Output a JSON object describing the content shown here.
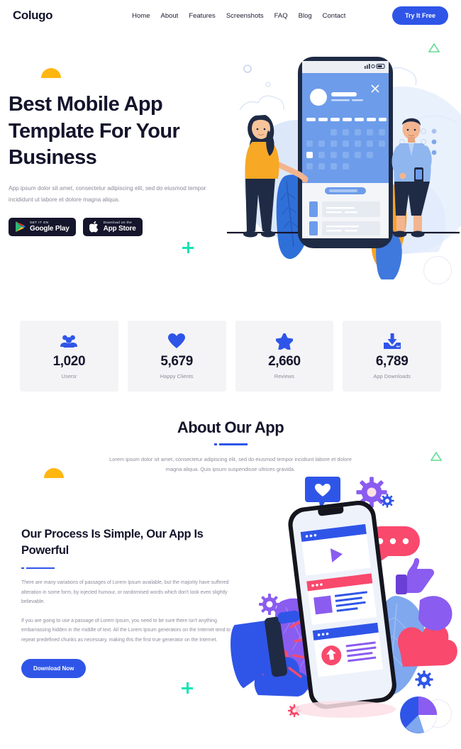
{
  "navbar": {
    "brand": "Colugo",
    "links": [
      {
        "label": "Home"
      },
      {
        "label": "About"
      },
      {
        "label": "Features"
      },
      {
        "label": "Screenshots"
      },
      {
        "label": "FAQ"
      },
      {
        "label": "Blog"
      },
      {
        "label": "Contact"
      }
    ],
    "cta": "Try It Free"
  },
  "hero": {
    "title": "Best Mobile App Template For Your Business",
    "subtitle": "App ipsum dolor sit amet, consectetur adipiscing elit, sed do eiusmod tempor incididunt ut labore et dolore magna aliqua.",
    "google_badge": {
      "top": "GET IT ON",
      "bottom": "Google Play"
    },
    "apple_badge": {
      "top": "Download on the",
      "bottom": "App Store"
    }
  },
  "stats": [
    {
      "icon": "users-icon",
      "value": "1,020",
      "label": "Usersr"
    },
    {
      "icon": "heart-icon",
      "value": "5,679",
      "label": "Happy Clients"
    },
    {
      "icon": "star-icon",
      "value": "2,660",
      "label": "Reviews"
    },
    {
      "icon": "download-icon",
      "value": "6,789",
      "label": "App Downloads"
    }
  ],
  "about": {
    "title": "About Our App",
    "subtitle": "Lorem ipsum dolor sit amet, consectetur adipiscing elit, sed do eiusmod tempor incidiunt labore et dolore magna aliqua. Quis ipsum suspendisse ultrices gravida."
  },
  "process": {
    "title": "Our Process Is Simple, Our App Is Powerful",
    "paragraph1": "There are many variations of passages of Lorem Ipsum available, but the majority have suffered alteration in some form, by injected humour, or randomised words which don't look even slightly believable.",
    "paragraph2": "If you are going to use a passage of Lorem Ipsum, you need to be sure there isn't anything embarrassing hidden in the middle of text. All the Lorem Ipsum generators on the Internet tend to repeat predefined chunks as necessary, making this the first true generator on the Internet.",
    "button": "Download Now"
  },
  "colors": {
    "accent": "#2f55e8",
    "dark": "#14142c",
    "muted": "#8d8d9d",
    "card_bg": "#f4f4f6",
    "orange": "#ffb611",
    "teal": "#0ce5b4",
    "green": "#5ddc8f",
    "pink": "#f9496d",
    "purple": "#7b4fe0"
  }
}
